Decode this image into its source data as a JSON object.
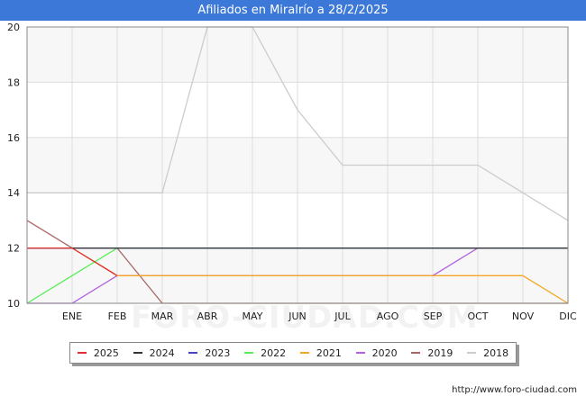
{
  "chart_data": {
    "type": "line",
    "title": "Afiliados en Miralrío a 28/2/2025",
    "categories": [
      "",
      "ENE",
      "FEB",
      "MAR",
      "ABR",
      "MAY",
      "JUN",
      "JUL",
      "AGO",
      "SEP",
      "OCT",
      "NOV",
      "DIC"
    ],
    "ylim": [
      10,
      20
    ],
    "yticks": [
      10,
      12,
      14,
      16,
      18,
      20
    ],
    "grid": true,
    "legend_position": "bottom",
    "series": [
      {
        "name": "2018",
        "color": "#cccccc",
        "values": [
          14,
          14,
          14,
          14,
          20,
          20,
          17,
          15,
          15,
          15,
          15,
          14,
          13
        ]
      },
      {
        "name": "2019",
        "color": "#aa6666",
        "values": [
          13,
          12,
          12,
          10,
          10,
          10,
          10,
          10,
          10,
          10,
          10,
          10,
          10
        ]
      },
      {
        "name": "2020",
        "color": "#b05fe0",
        "values": [
          10,
          10,
          11,
          11,
          11,
          11,
          11,
          11,
          11,
          11,
          12,
          12,
          12
        ]
      },
      {
        "name": "2021",
        "color": "#f5a623",
        "values": [
          12,
          12,
          11,
          11,
          11,
          11,
          11,
          11,
          11,
          11,
          11,
          11,
          10
        ]
      },
      {
        "name": "2022",
        "color": "#55ee55",
        "values": [
          10,
          11,
          12,
          12,
          12,
          12,
          12,
          12,
          12,
          12,
          12,
          12,
          12
        ]
      },
      {
        "name": "2023",
        "color": "#4444cc",
        "values": [
          12,
          12,
          12,
          12,
          12,
          12,
          12,
          12,
          12,
          12,
          12,
          12,
          12
        ]
      },
      {
        "name": "2024",
        "color": "#333333",
        "values": [
          12,
          12,
          12,
          12,
          12,
          12,
          12,
          12,
          12,
          12,
          12,
          12,
          12
        ]
      },
      {
        "name": "2025",
        "color": "#e03030",
        "values": [
          12,
          12,
          11
        ]
      }
    ],
    "legend_order": [
      "2025",
      "2024",
      "2023",
      "2022",
      "2021",
      "2020",
      "2019",
      "2018"
    ]
  },
  "watermark": "FORO-CIUDAD.COM",
  "credit": "http://www.foro-ciudad.com"
}
